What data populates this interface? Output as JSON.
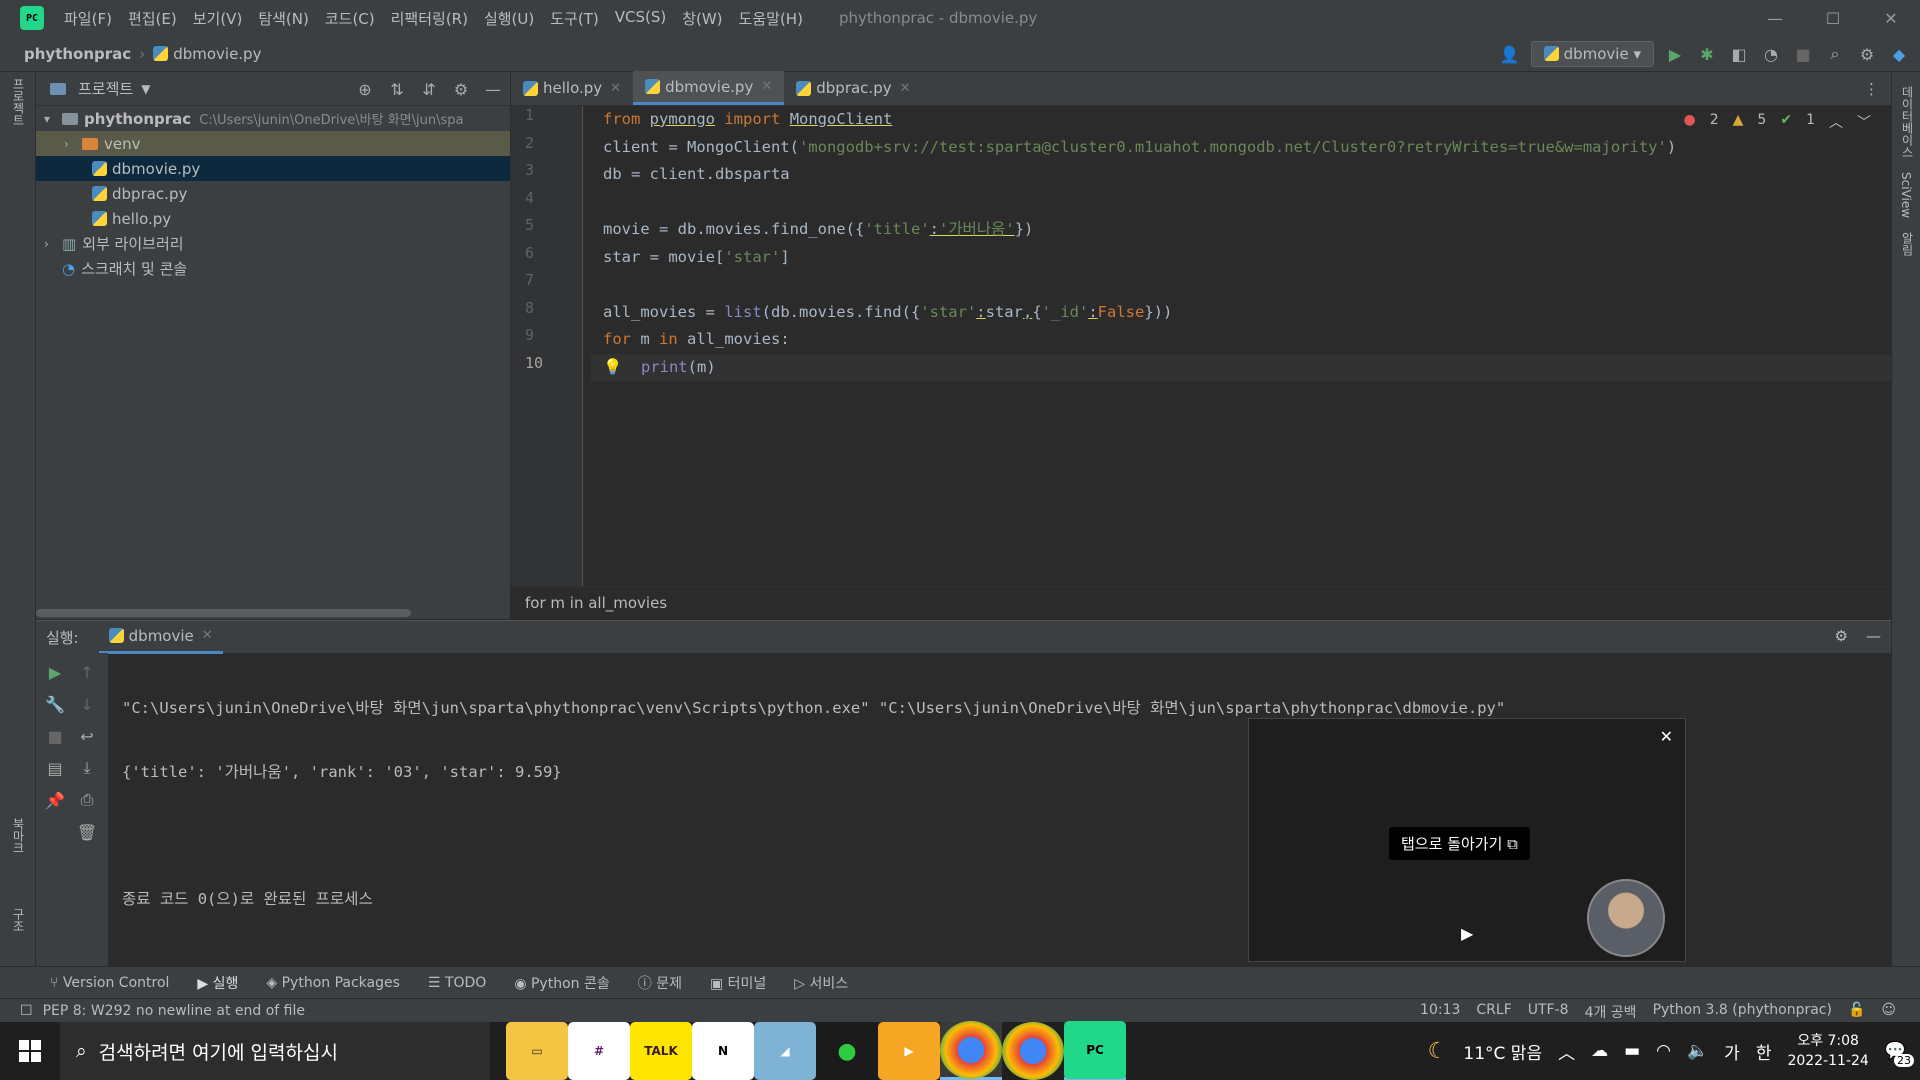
{
  "app": {
    "title": "phythonprac - dbmovie.py",
    "logo": "PC"
  },
  "menu": [
    "파일(F)",
    "편집(E)",
    "보기(V)",
    "탐색(N)",
    "코드(C)",
    "리팩터링(R)",
    "실행(U)",
    "도구(T)",
    "VCS(S)",
    "창(W)",
    "도움말(H)"
  ],
  "navbar": {
    "project": "phythonprac",
    "file": "dbmovie.py",
    "run_config": "dbmovie"
  },
  "left_strip": {
    "project_label": "프로젝트",
    "bookmarks_label": "북마크",
    "structure_label": "구조"
  },
  "right_strip": {
    "db_label": "데이터베이스",
    "sciview_label": "SciView",
    "notify_label": "알림"
  },
  "project_panel": {
    "title": "프로젝트",
    "root": {
      "name": "phythonprac",
      "path": "C:\\Users\\junin\\OneDrive\\바탕 화면\\jun\\spa"
    },
    "items": [
      {
        "name": "venv",
        "type": "folder"
      },
      {
        "name": "dbmovie.py",
        "type": "file",
        "selected": true
      },
      {
        "name": "dbprac.py",
        "type": "file"
      },
      {
        "name": "hello.py",
        "type": "file"
      }
    ],
    "external_libs": "외부 라이브러리",
    "scratches": "스크래치 및 콘솔"
  },
  "tabs": [
    {
      "label": "hello.py"
    },
    {
      "label": "dbmovie.py",
      "active": true
    },
    {
      "label": "dbprac.py"
    }
  ],
  "inspections": {
    "errors": "2",
    "warnings": "5",
    "ok": "1"
  },
  "code": {
    "line_numbers": [
      "1",
      "2",
      "3",
      "4",
      "5",
      "6",
      "7",
      "8",
      "9",
      "10"
    ],
    "l1": {
      "k1": "from",
      "mod": "pymongo",
      "k2": "import",
      "cls": "MongoClient"
    },
    "l2": {
      "pre": "client = MongoClient(",
      "str": "'mongodb+srv://test:sparta@cluster0.m1uahot.mongodb.net/Cluster0?retryWrites=true&w=majority'",
      "post": ")"
    },
    "l3": "db = client.dbsparta",
    "l5": {
      "pre": "movie = db.movies.find_one({",
      "s1": "'title'",
      "colon": ":",
      "s2": "'가버나움'",
      "post": "})"
    },
    "l6": {
      "pre": "star = movie[",
      "s": "'star'",
      "post": "]"
    },
    "l8": {
      "pre": "all_movies = ",
      "fn": "list",
      "mid": "(db.movies.find({",
      "s1": "'star'",
      "c1": ":",
      "v1": "star",
      "comma": ",",
      "b": "{",
      "s2": "'_id'",
      "c2": ":",
      "v2": "False",
      "post": "}))"
    },
    "l9": {
      "k1": "for",
      "mid": " m ",
      "k2": "in",
      "post": " all_movies:"
    },
    "l10": {
      "fn": "print",
      "post": "(m)"
    }
  },
  "editor_breadcrumb": "for m in all_movies",
  "run_panel": {
    "label": "실행:",
    "tab": "dbmovie",
    "output": [
      "\"C:\\Users\\junin\\OneDrive\\바탕 화면\\jun\\sparta\\phythonprac\\venv\\Scripts\\python.exe\" \"C:\\Users\\junin\\OneDrive\\바탕 화면\\jun\\sparta\\phythonprac\\dbmovie.py\"",
      "{'title': '가버나움', 'rank': '03', 'star': 9.59}",
      "",
      "종료 코드 0(으)로 완료된 프로세스"
    ]
  },
  "pip": {
    "back_label": "탭으로 돌아가기"
  },
  "bottom_tabs": [
    "Version Control",
    "실행",
    "Python Packages",
    "TODO",
    "Python 콘솔",
    "문제",
    "터미널",
    "서비스"
  ],
  "status": {
    "message": "PEP 8: W292 no newline at end of file",
    "position": "10:13",
    "line_sep": "CRLF",
    "encoding": "UTF-8",
    "indent": "4개 공백",
    "interpreter": "Python 3.8 (phythonprac)"
  },
  "taskbar": {
    "search_placeholder": "검색하려면 여기에 입력하십시",
    "weather": "11°C 맑음",
    "ime1": "가",
    "ime2": "한",
    "time": "오후 7:08",
    "date": "2022-11-24",
    "notifications": "23"
  }
}
